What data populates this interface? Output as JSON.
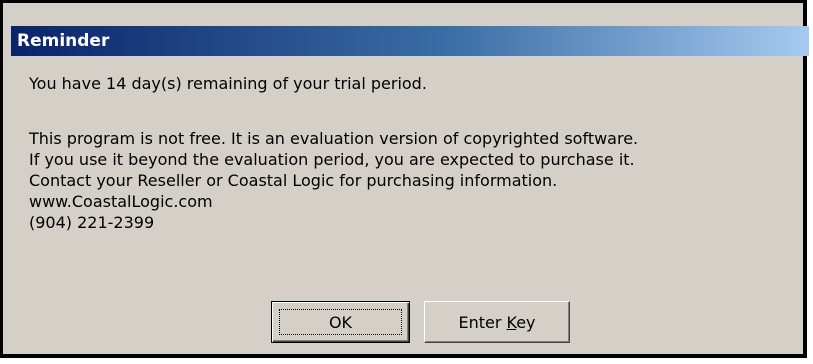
{
  "dialog": {
    "title": "Reminder",
    "message_line1": "You have 14 day(s) remaining of your trial period.",
    "message_line2": "This program is not free. It is an evaluation version of copyrighted software.",
    "message_line3": "If you use it beyond the evaluation period, you are expected to purchase it.",
    "message_line4": "Contact your Reseller or Coastal Logic for purchasing information.",
    "website": "www.CoastalLogic.com",
    "phone": "(904) 221-2399"
  },
  "buttons": {
    "ok_label": "OK",
    "enter_key_prefix": "Enter ",
    "enter_key_accel": "K",
    "enter_key_suffix": "ey"
  },
  "colors": {
    "title_gradient_start": "#0a246a",
    "title_gradient_end": "#a6caf0",
    "dialog_face": "#d4d0c8"
  }
}
